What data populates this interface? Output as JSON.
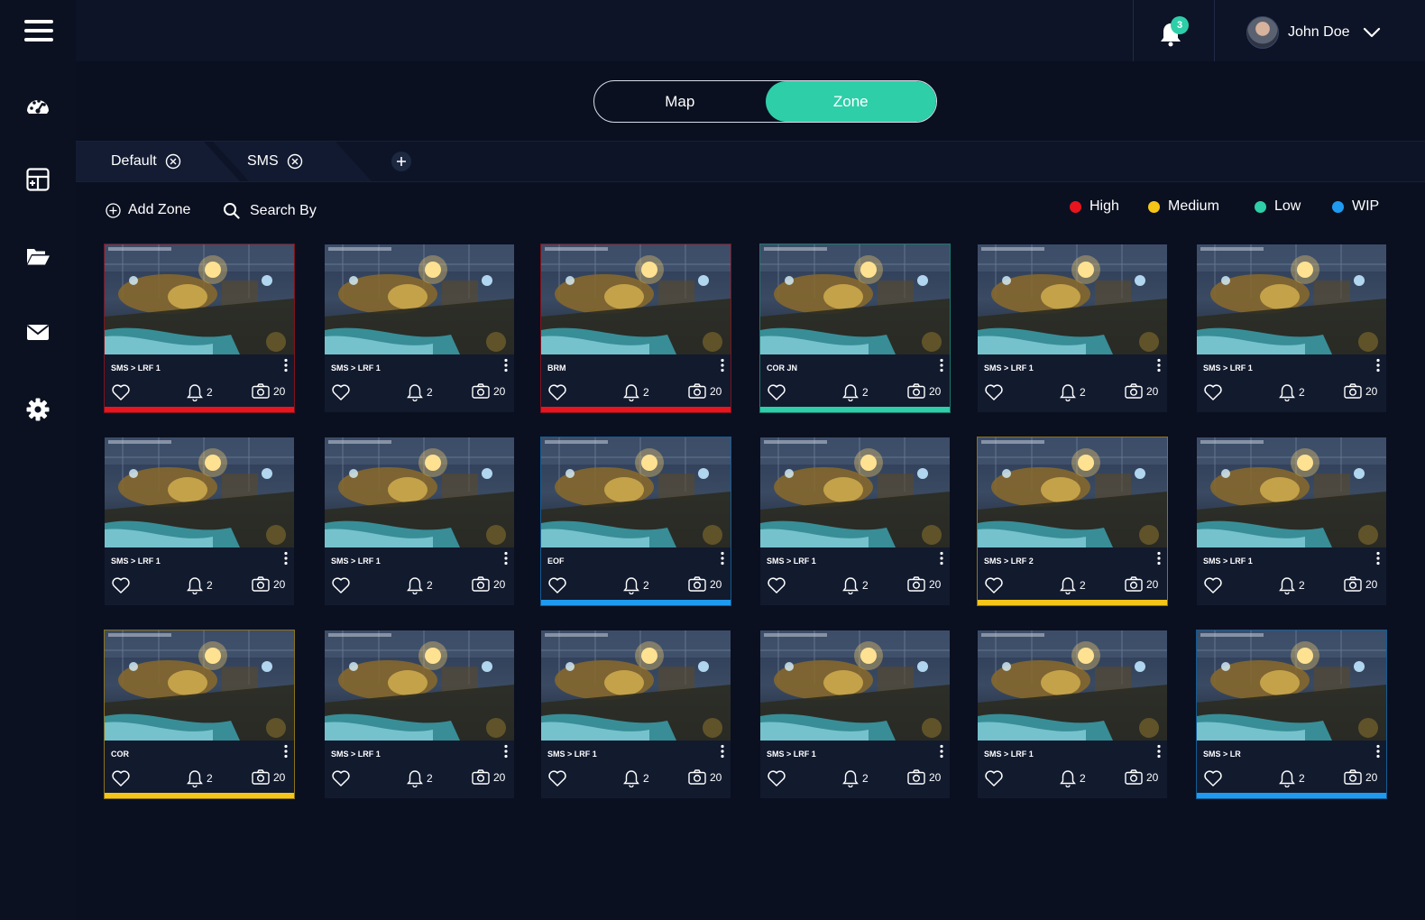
{
  "header": {
    "notification_count": "3",
    "user_name": "John Doe"
  },
  "sidebar": {
    "items": [
      {
        "icon": "dashboard-icon"
      },
      {
        "icon": "layout-add-icon"
      },
      {
        "icon": "folder-open-icon"
      },
      {
        "icon": "mail-icon"
      },
      {
        "icon": "settings-icon"
      }
    ]
  },
  "view_toggle": {
    "map_label": "Map",
    "zone_label": "Zone",
    "active": "Zone"
  },
  "tabs": [
    {
      "label": "Default"
    },
    {
      "label": "SMS"
    }
  ],
  "toolbar": {
    "add_zone_label": "Add Zone",
    "search_label": "Search By"
  },
  "legend": [
    {
      "label": "High",
      "color": "#e8141e"
    },
    {
      "label": "Medium",
      "color": "#f5c518"
    },
    {
      "label": "Low",
      "color": "#2dcea8"
    },
    {
      "label": "WIP",
      "color": "#1e9bf0"
    }
  ],
  "cards": [
    {
      "title": "SMS > LRF 1",
      "alerts": "2",
      "snapshots": "20",
      "severity": "high"
    },
    {
      "title": "SMS > LRF 1",
      "alerts": "2",
      "snapshots": "20",
      "severity": "none"
    },
    {
      "title": "BRM",
      "alerts": "2",
      "snapshots": "20",
      "severity": "high"
    },
    {
      "title": "COR JN",
      "alerts": "2",
      "snapshots": "20",
      "severity": "low"
    },
    {
      "title": "SMS > LRF 1",
      "alerts": "2",
      "snapshots": "20",
      "severity": "none"
    },
    {
      "title": "SMS > LRF 1",
      "alerts": "2",
      "snapshots": "20",
      "severity": "none"
    },
    {
      "title": "SMS > LRF 1",
      "alerts": "2",
      "snapshots": "20",
      "severity": "none"
    },
    {
      "title": "SMS > LRF 1",
      "alerts": "2",
      "snapshots": "20",
      "severity": "none"
    },
    {
      "title": "EOF",
      "alerts": "2",
      "snapshots": "20",
      "severity": "wip"
    },
    {
      "title": "SMS > LRF 1",
      "alerts": "2",
      "snapshots": "20",
      "severity": "none"
    },
    {
      "title": "SMS > LRF 2",
      "alerts": "2",
      "snapshots": "20",
      "severity": "medium"
    },
    {
      "title": "SMS > LRF 1",
      "alerts": "2",
      "snapshots": "20",
      "severity": "none"
    },
    {
      "title": "COR",
      "alerts": "2",
      "snapshots": "20",
      "severity": "medium"
    },
    {
      "title": "SMS > LRF 1",
      "alerts": "2",
      "snapshots": "20",
      "severity": "none"
    },
    {
      "title": "SMS > LRF 1",
      "alerts": "2",
      "snapshots": "20",
      "severity": "none"
    },
    {
      "title": "SMS > LRF 1",
      "alerts": "2",
      "snapshots": "20",
      "severity": "none"
    },
    {
      "title": "SMS > LRF 1",
      "alerts": "2",
      "snapshots": "20",
      "severity": "none"
    },
    {
      "title": "SMS > LR",
      "alerts": "2",
      "snapshots": "20",
      "severity": "wip"
    }
  ]
}
